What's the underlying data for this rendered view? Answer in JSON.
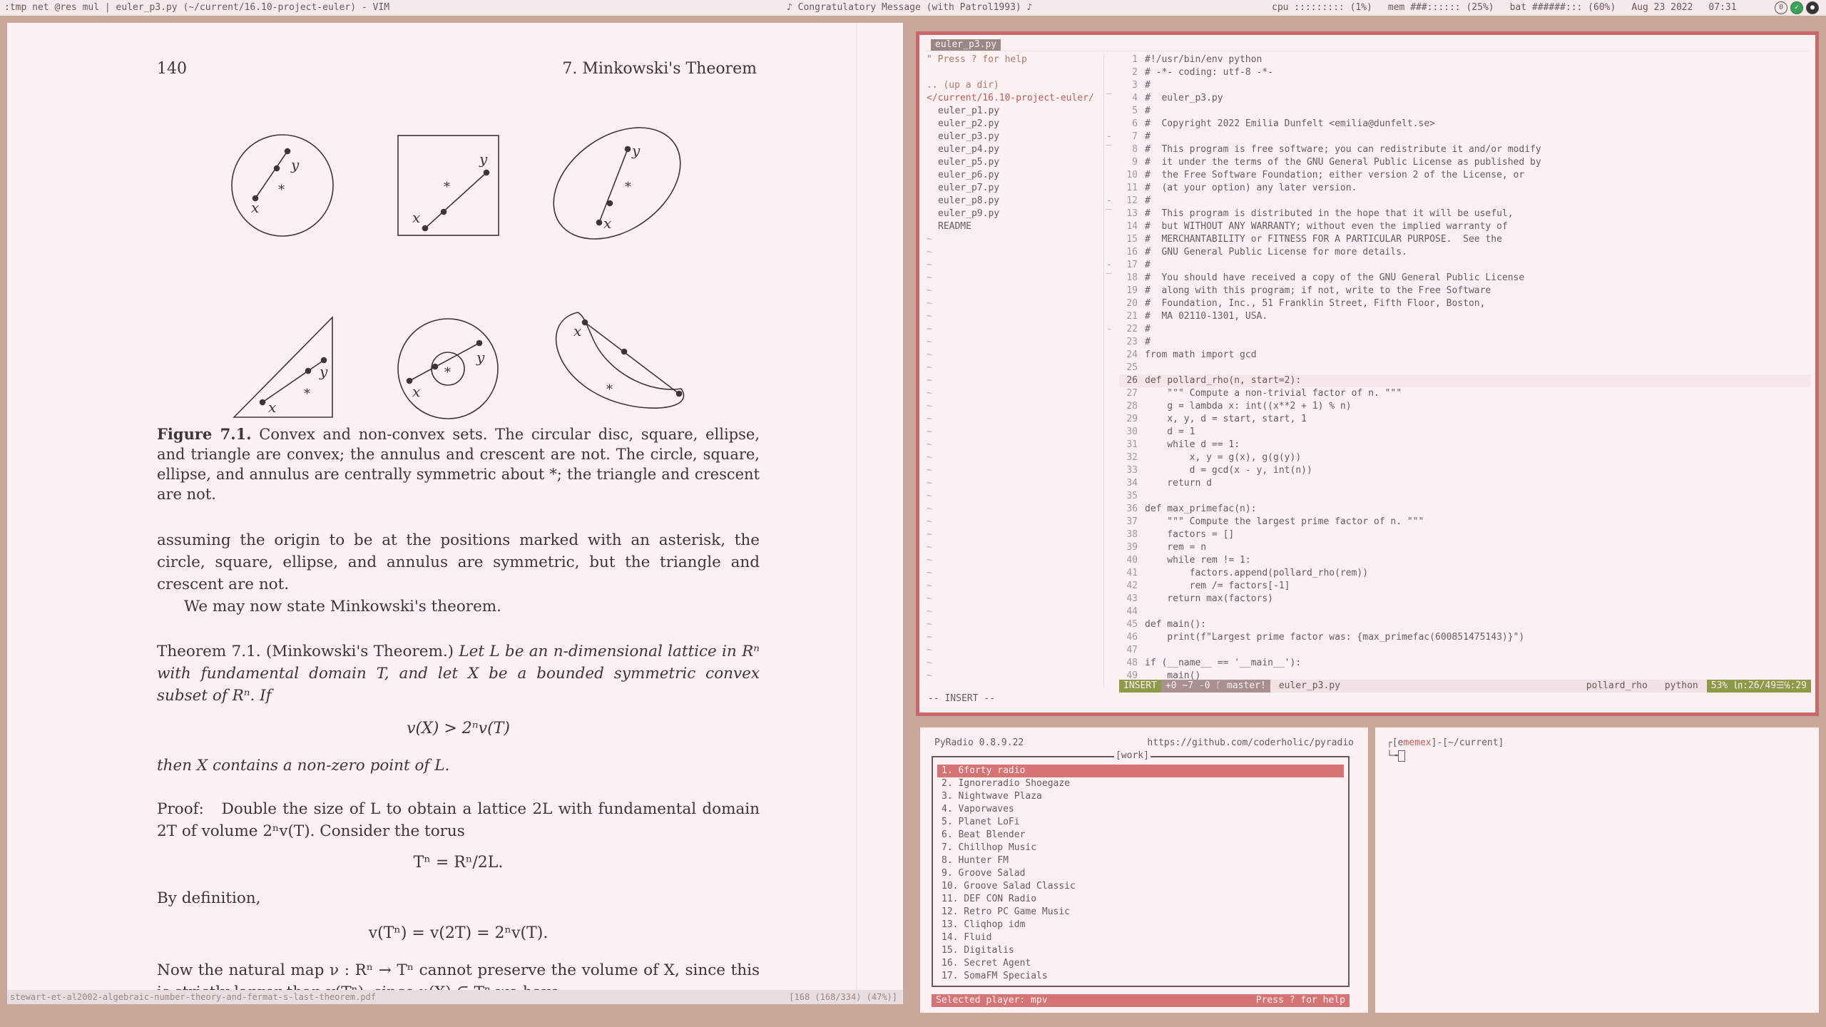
{
  "topbar": {
    "left": ":tmp net @res mul | euler_p3.py (~/current/16.10-project-euler) - VIM",
    "center": "♪ Congratulatory Message (with Patrol1993) ♪",
    "cpu": "cpu ::::::::: (1%)",
    "mem": "mem ###:::::: (25%)",
    "bat": "bat ######::: (60%)",
    "date": "Aug 23 2022",
    "time": "07:31",
    "tray_icons": [
      "circle-icon",
      "check-icon",
      "dark-circle-icon"
    ]
  },
  "pdf": {
    "page_number": "140",
    "chapter": "7.  Minkowski's Theorem",
    "figure_label": "Figure 7.1.",
    "caption": "Convex and non-convex sets. The circular disc, square, ellipse, and triangle are convex; the annulus and crescent are not. The circle, square, ellipse, and annulus are centrally symmetric about *; the triangle and crescent are not.",
    "para1": "assuming the origin to be at the positions marked with an asterisk, the circle, square, ellipse, and annulus are symmetric, but the triangle and crescent are not.",
    "para2": "We may now state Minkowski's theorem.",
    "theorem_head": "Theorem 7.1. (Minkowski's Theorem.)",
    "eq1": "v(X) > 2ⁿv(T)",
    "then_line": "then X contains a non-zero point of L.",
    "proof_label": "Proof:",
    "proof_text": "Double the size of L to obtain a lattice 2L with fundamental domain 2T of volume 2ⁿv(T). Consider the torus",
    "eq2": "Tⁿ = Rⁿ/2L.",
    "by_def": "By definition,",
    "eq3": "v(Tⁿ) = v(2T) = 2ⁿv(T).",
    "last_para": "Now the natural map ν : Rⁿ → Tⁿ cannot preserve the volume of X, since this is strictly larger than v(Tⁿ): since ν(X) ⊆ Tⁿ we have",
    "status_file": "stewart-et-al2002-algebraic-number-theory-and-fermat-s-last-theorem.pdf",
    "status_page": "[168 (168/334) (47%)]",
    "fig_labels": {
      "x": "x",
      "y": "y",
      "star": "*"
    }
  },
  "vim": {
    "tab_label": "euler_p3.py",
    "tree": [
      {
        "t": "\" Press ? for help",
        "kind": "help"
      },
      {
        "t": "",
        "kind": "blank"
      },
      {
        "t": ".. (up a dir)",
        "kind": "help"
      },
      {
        "t": "</current/16.10-project-euler/",
        "kind": "dir"
      },
      {
        "t": "euler_p1.py",
        "kind": "file"
      },
      {
        "t": "euler_p2.py",
        "kind": "file"
      },
      {
        "t": "euler_p3.py",
        "kind": "file"
      },
      {
        "t": "euler_p4.py",
        "kind": "file"
      },
      {
        "t": "euler_p5.py",
        "kind": "file"
      },
      {
        "t": "euler_p6.py",
        "kind": "file"
      },
      {
        "t": "euler_p7.py",
        "kind": "file"
      },
      {
        "t": "euler_p8.py",
        "kind": "file"
      },
      {
        "t": "euler_p9.py",
        "kind": "file"
      },
      {
        "t": "README",
        "kind": "file"
      }
    ],
    "code": [
      {
        "n": "1",
        "t": "#!/usr/bin/env python"
      },
      {
        "n": "2",
        "t": "# -*- coding: utf-8 -*-"
      },
      {
        "n": "3",
        "t": "#",
        "c": true
      },
      {
        "n": "4",
        "t": "#  euler_p3.py",
        "c": true
      },
      {
        "n": "5",
        "t": "#",
        "c": true
      },
      {
        "n": "6",
        "t": "#  Copyright 2022 Emilia Dunfelt <emilia@dunfelt.se>",
        "c": true
      },
      {
        "n": "7",
        "t": "#",
        "c": true
      },
      {
        "n": "8",
        "t": "#  This program is free software; you can redistribute it and/or modify",
        "c": true
      },
      {
        "n": "9",
        "t": "#  it under the terms of the GNU General Public License as published by",
        "c": true
      },
      {
        "n": "10",
        "t": "#  the Free Software Foundation; either version 2 of the License, or",
        "c": true
      },
      {
        "n": "11",
        "t": "#  (at your option) any later version.",
        "c": true
      },
      {
        "n": "12",
        "t": "#",
        "c": true
      },
      {
        "n": "13",
        "t": "#  This program is distributed in the hope that it will be useful,",
        "c": true
      },
      {
        "n": "14",
        "t": "#  but WITHOUT ANY WARRANTY; without even the implied warranty of",
        "c": true
      },
      {
        "n": "15",
        "t": "#  MERCHANTABILITY or FITNESS FOR A PARTICULAR PURPOSE.  See the",
        "c": true
      },
      {
        "n": "16",
        "t": "#  GNU General Public License for more details.",
        "c": true
      },
      {
        "n": "17",
        "t": "#",
        "c": true
      },
      {
        "n": "18",
        "t": "#  You should have received a copy of the GNU General Public License",
        "c": true
      },
      {
        "n": "19",
        "t": "#  along with this program; if not, write to the Free Software",
        "c": true
      },
      {
        "n": "20",
        "t": "#  Foundation, Inc., 51 Franklin Street, Fifth Floor, Boston,",
        "c": true
      },
      {
        "n": "21",
        "t": "#  MA 02110-1301, USA.",
        "c": true
      },
      {
        "n": "22",
        "t": "#",
        "c": true
      },
      {
        "n": "23",
        "t": "#",
        "c": true
      },
      {
        "n": "24",
        "t": "from math import gcd"
      },
      {
        "n": "25",
        "t": ""
      },
      {
        "n": "26",
        "t": "def pollard_rho(n, start=2):",
        "cur": true
      },
      {
        "n": "27",
        "t": "    \"\"\" Compute a non-trivial factor of n. \"\"\""
      },
      {
        "n": "28",
        "t": "    g = lambda x: int((x**2 + 1) % n)"
      },
      {
        "n": "29",
        "t": "    x, y, d = start, start, 1"
      },
      {
        "n": "30",
        "t": "    d = 1"
      },
      {
        "n": "31",
        "t": "    while d == 1:"
      },
      {
        "n": "32",
        "t": "        x, y = g(x), g(g(y))"
      },
      {
        "n": "33",
        "t": "        d = gcd(x - y, int(n))"
      },
      {
        "n": "34",
        "t": "    return d"
      },
      {
        "n": "35",
        "t": ""
      },
      {
        "n": "36",
        "t": "def max_primefac(n):"
      },
      {
        "n": "37",
        "t": "    \"\"\" Compute the largest prime factor of n. \"\"\""
      },
      {
        "n": "38",
        "t": "    factors = []"
      },
      {
        "n": "39",
        "t": "    rem = n"
      },
      {
        "n": "40",
        "t": "    while rem != 1:"
      },
      {
        "n": "41",
        "t": "        factors.append(pollard_rho(rem))"
      },
      {
        "n": "42",
        "t": "        rem /= factors[-1]"
      },
      {
        "n": "43",
        "t": "    return max(factors)"
      },
      {
        "n": "44",
        "t": ""
      },
      {
        "n": "45",
        "t": "def main():"
      },
      {
        "n": "46",
        "t": "    print(f\"Largest prime factor was: {max_primefac(600851475143)}\")"
      },
      {
        "n": "47",
        "t": ""
      },
      {
        "n": "48",
        "t": "if (__name__ == '__main__'):"
      },
      {
        "n": "49",
        "t": "    main()"
      }
    ],
    "status": {
      "mode": "INSERT",
      "git": "+0 ~7 -0 ᚴ master!",
      "file": "euler_p3.py",
      "func": "pollard_rho",
      "filetype": "python",
      "position": "53% ㏑:26/49☰℅:29"
    },
    "insert_line": "-- INSERT --"
  },
  "pyradio": {
    "title": "PyRadio 0.8.9.22",
    "url": "https://github.com/coderholic/pyradio",
    "playlist": "[work]",
    "stations": [
      "1. 6forty radio",
      "2. Ignoreradio Shoegaze",
      "3. Nightwave Plaza",
      "4. Vaporwaves",
      "5. Planet LoFi",
      "6. Beat Blender",
      "7. Chillhop Music",
      "8. Hunter FM",
      "9. Groove Salad",
      "10. Groove Salad Classic",
      "11. DEF CON Radio",
      "12. Retro PC Game Music",
      "13. Cliqhop idm",
      "14. Fluid",
      "15. Digitalis",
      "16. Secret Agent",
      "17. SomaFM Specials"
    ],
    "footer_left": "Selected player: mpv",
    "footer_right": "Press ? for help"
  },
  "terminal": {
    "prompt_prefix": "┌[e",
    "prompt_user": "memex",
    "prompt_rest": "]-[~/current]",
    "prompt2": "└╼"
  }
}
